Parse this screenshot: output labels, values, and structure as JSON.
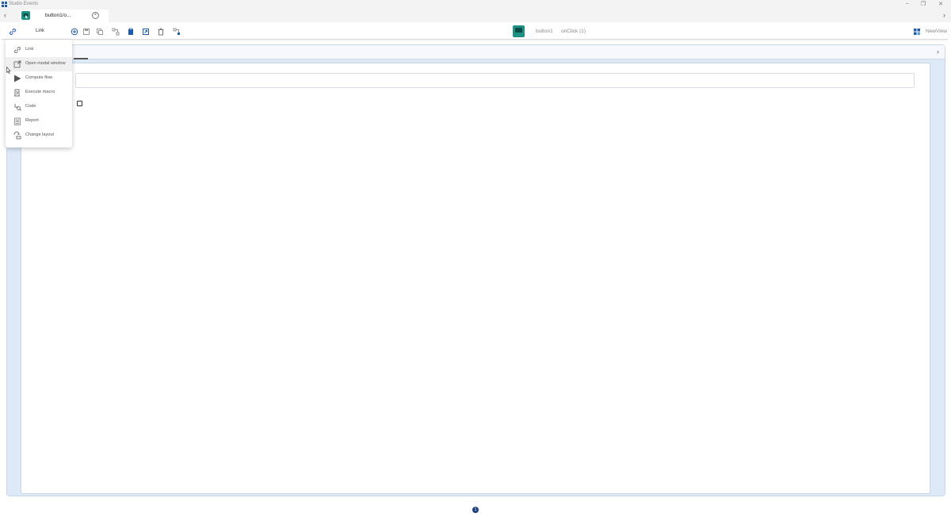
{
  "window": {
    "title": "Studio Events",
    "minimize_glyph": "–",
    "restore_glyph": "❐",
    "close_glyph": "✕"
  },
  "tabstrip": {
    "back_glyph": "‹",
    "forward_glyph": "›",
    "active_tab": {
      "label": "button1/o...",
      "close_glyph": "×"
    }
  },
  "toolbar": {
    "link_label": "Link",
    "icons": [
      "link-icon",
      "add-icon",
      "save-icon",
      "copy-icon",
      "flow-icon",
      "paste-icon",
      "export-icon",
      "delete-icon",
      "layout-icon"
    ],
    "component_name": "button1",
    "event_name": "onClick (1)",
    "view_label": "NewView"
  },
  "menu": {
    "items": [
      {
        "label": "Link",
        "icon": "link-icon"
      },
      {
        "label": "Open modal window",
        "icon": "open-modal-icon"
      },
      {
        "label": "Compute flow",
        "icon": "play-icon"
      },
      {
        "label": "Execute macro",
        "icon": "macro-icon"
      },
      {
        "label": "Code",
        "icon": "code-icon"
      },
      {
        "label": "Report",
        "icon": "report-icon"
      },
      {
        "label": "Change layout",
        "icon": "change-layout-icon"
      }
    ],
    "hovered_index": 1
  },
  "main": {
    "chevron_glyph": "›"
  },
  "footer": {
    "page_indicator": "1"
  },
  "colors": {
    "accent_teal": "#1d8f83",
    "accent_blue": "#1e5ba8",
    "main_background": "#dde9f7",
    "page_dot": "#1f3f7a"
  }
}
